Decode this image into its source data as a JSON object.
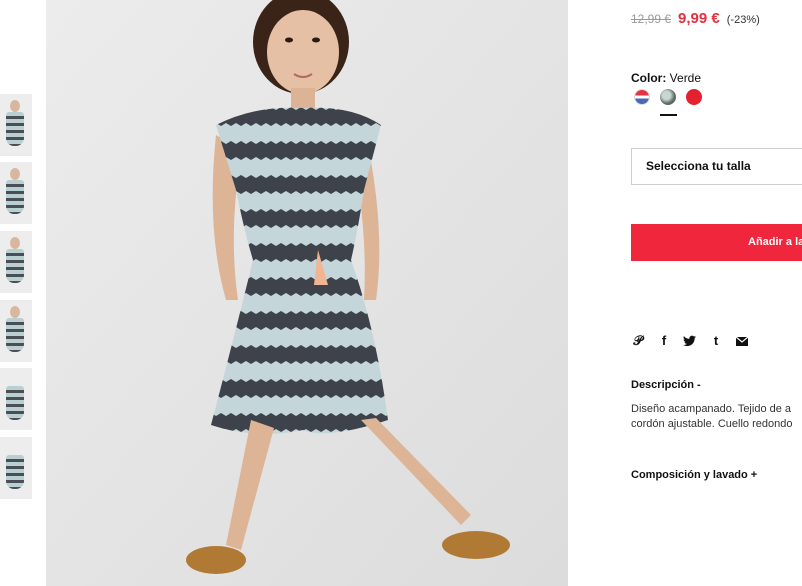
{
  "product": {
    "old_price": "12,99 €",
    "price": "9,99 €",
    "discount": "(-23%)",
    "color_label": "Color:",
    "color_value": "Verde",
    "size_placeholder": "Selecciona tu talla",
    "add_to_cart": "Añadir a la",
    "description_title": "Descripción  -",
    "description_line1": "Diseño acampanado. Tejido de a",
    "description_line2": "cordón ajustable. Cuello redondo",
    "composition_title": "Composición y lavado  +"
  },
  "swatches": [
    {
      "name": "stripes-red-white-blue",
      "colors": [
        "#e8323f",
        "#ffffff",
        "#4a67b8"
      ]
    },
    {
      "name": "verde",
      "colors": [
        "#5d6a63",
        "#c9d6d1"
      ]
    },
    {
      "name": "red",
      "colors": [
        "#e4212f"
      ]
    }
  ],
  "share_icons": [
    "pinterest-icon",
    "facebook-icon",
    "twitter-icon",
    "tumblr-icon",
    "mail-icon"
  ],
  "colors": {
    "accent": "#f0273c",
    "price": "#e4303f"
  }
}
